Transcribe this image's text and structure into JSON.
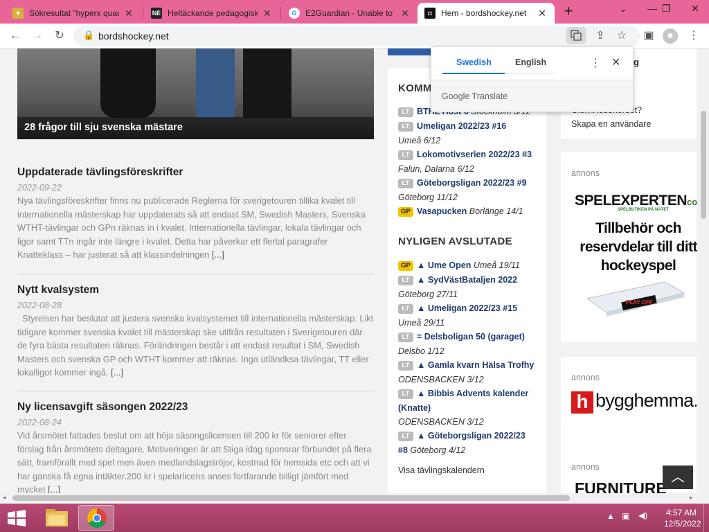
{
  "browser": {
    "tabs": [
      {
        "title": "Sökresultat \"hyperx quad",
        "favicon": "hyperx-icon",
        "active": false
      },
      {
        "title": "Heltäckande pedagogisk",
        "favicon": "ne-icon",
        "active": false
      },
      {
        "title": "E2Guardian - Unable to",
        "favicon": "google-icon",
        "active": false
      },
      {
        "title": "Hem - bordshockey.net",
        "favicon": "bordshockey-icon",
        "active": true
      }
    ],
    "url": "bordshockey.net",
    "accent": "#e8659a"
  },
  "translate_popup": {
    "source_lang": "Swedish",
    "target_lang": "English",
    "provider": "Google",
    "provider_suffix": "Translate"
  },
  "hero": {
    "caption": "28 frågor till sju svenska mästare"
  },
  "posts": [
    {
      "title": "Uppdaterade tävlingsföreskrifter",
      "date": "2022-09-22",
      "excerpt": "Nya tävlingsföreskrifter finns nu publicerade Reglerna för sverigetouren tillika kvalet till internationella mästerskap har uppdaterats så att endast SM, Swedish Masters, Svenska WTHT-tävlingar och GPn räknas in i kvalet. Internationella tävlingar, lokala tävlingar och ligor samt TTn ingår inte längre i kvalet. Detta har påverkar ett flertal paragrafer Knatteklass – har justerat så att klassindelningen",
      "more": "[...]"
    },
    {
      "title": "Nytt kvalsystem",
      "date": "2022-08-28",
      "excerpt": "  Styrelsen har beslutat att justera svenska kvalsystemet till internationella mästerskap. Likt tidigare kommer svenska kvalet till mästerskap ske utifrån resultaten i Sverigetouren där de fyra bästa resultaten räknas. Förändringen består i att endast resultat i SM, Swedish Masters och svenska GP och WTHT kommer att räknas. Inga utländksa tävlingar, TT eller lokalligor kommer ingå.",
      "more": "[...]"
    },
    {
      "title": "Ny licensavgift säsongen 2022/23",
      "date": "2022-08-24",
      "excerpt": "Vid årsmötet fattades beslut om att höja säsongslicensen till 200 kr för seniorer efter förslag från årsmötets deltagare. Motiveringen är att Stiga idag sponsrar förbundet på flera sätt, framförallt med spel men även medlandslagströjor, kostnad för hemsida etc och att vi har ganska få egna intäkter.200 kr i spelarlicens anses fortfarande billigt jämfört med mycket",
      "more": "[...]"
    }
  ],
  "sidebar": {
    "upcoming_heading": "KOMM",
    "upcoming": [
      {
        "badge": "LT",
        "name": "BTHL Höst 6",
        "place": "Stockholm 3/12"
      },
      {
        "badge": "LT",
        "name": "Umeligan 2022/23 #16",
        "place": "Umeå 6/12"
      },
      {
        "badge": "LT",
        "name": "Lokomotivserien 2022/23 #3",
        "place": "Falun, Dalarna 6/12"
      },
      {
        "badge": "LT",
        "name": "Göteborgsligan 2022/23 #9",
        "place": "Göteborg 11/12"
      },
      {
        "badge": "GP",
        "name": "Vasapucken",
        "place": "Borlänge 14/1"
      }
    ],
    "finished_heading": "NYLIGEN AVSLUTADE",
    "finished": [
      {
        "badge": "GP",
        "name": "▲ Ume Open",
        "place": "Umeå 19/11"
      },
      {
        "badge": "LT",
        "name": "▲ SydVästBataljen 2022",
        "place": "Göteborg 27/11"
      },
      {
        "badge": "LT",
        "name": "▲ Umeligan 2022/23 #15",
        "place": "Umeå 29/11"
      },
      {
        "badge": "LT",
        "name": "= Delsboligan 50 (garaget)",
        "place": "Delsbo 1/12"
      },
      {
        "badge": "LT",
        "name": "▲ Gamla kvarn Hälsa Trofhy",
        "place": "ODENSBACKEN 3/12"
      },
      {
        "badge": "LT",
        "name": "▲ Bibbis Advents kalender (Knatte)",
        "place": "ODENSBACKEN 3/12"
      },
      {
        "badge": "LT",
        "name": "▲ Göteborgsligan 2022/23 #8",
        "place": "Göteborg 4/12"
      }
    ],
    "calendar_link": "Visa tävlingskalendern"
  },
  "right_col": {
    "login_partial": "g",
    "forgot_password": "Glömt lösenordet?",
    "create_user": "Skapa en användare",
    "ad_label": "annons",
    "ad1": {
      "brand": "SPELEXPERTEN",
      "brand_tld": "co",
      "tagline": "SPELBUTIKEN PÅ NÄTET",
      "headline": "Tillbehör och reservdelar till ditt hockeyspel",
      "product": "PLAY OFF"
    },
    "ad2": {
      "logo_letter": "h",
      "brand": "bygghemma.s"
    },
    "ad3": {
      "brand": "FURNITURE"
    }
  },
  "taskbar": {
    "time": "4:57 AM",
    "date": "12/5/2022"
  }
}
